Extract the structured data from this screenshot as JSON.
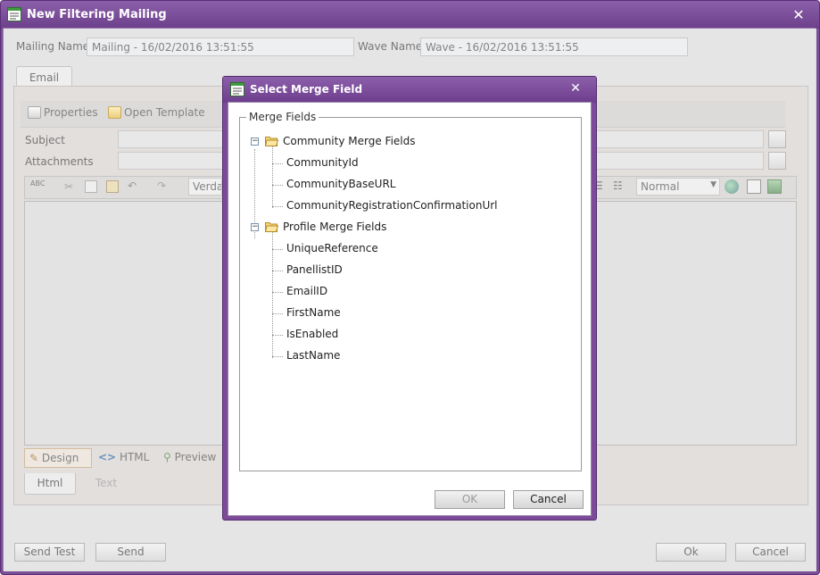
{
  "window": {
    "title": "New Filtering Mailing",
    "close_glyph": "✕"
  },
  "form": {
    "mailing_name_label": "Mailing Name",
    "mailing_name_value": "Mailing - 16/02/2016 13:51:55",
    "wave_name_label": "Wave Name",
    "wave_name_value": "Wave - 16/02/2016 13:51:55"
  },
  "tabs": {
    "email": "Email"
  },
  "toolbar": {
    "properties": "Properties",
    "open_template": "Open Template"
  },
  "email_form": {
    "subject_label": "Subject",
    "attachments_label": "Attachments",
    "font_value": "Verda",
    "paragraph_value": "Normal"
  },
  "editor_modes": {
    "design": "Design",
    "html": "HTML",
    "preview": "Preview"
  },
  "bottom_tabs": {
    "html": "Html",
    "text": "Text"
  },
  "footer": {
    "send_test": "Send Test",
    "send": "Send",
    "ok": "Ok",
    "cancel": "Cancel"
  },
  "dialog": {
    "title": "Select Merge Field",
    "close_glyph": "✕",
    "legend": "Merge Fields",
    "groups": [
      {
        "label": "Community Merge Fields",
        "expander": "−",
        "items": [
          "CommunityId",
          "CommunityBaseURL",
          "CommunityRegistrationConfirmationUrl"
        ]
      },
      {
        "label": "Profile Merge Fields",
        "expander": "−",
        "items": [
          "UniqueReference",
          "PanellistID",
          "EmailID",
          "FirstName",
          "IsEnabled",
          "LastName"
        ]
      }
    ],
    "ok": "OK",
    "cancel": "Cancel"
  },
  "colors": {
    "window_chrome": "#7b4f96",
    "dialog_chrome": "#7c4a99"
  }
}
